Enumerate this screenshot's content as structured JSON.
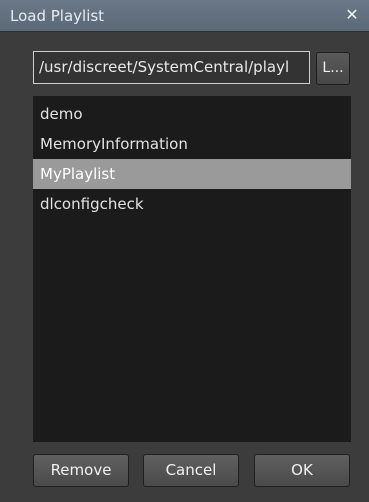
{
  "window": {
    "title": "Load Playlist",
    "close_glyph": "✕"
  },
  "path": {
    "value": "/usr/discreet/SystemCentral/playl",
    "browse_label": "L..."
  },
  "list": {
    "items": [
      "demo",
      "MemoryInformation",
      "MyPlaylist",
      "dlconfigcheck"
    ],
    "selected_index": 2
  },
  "buttons": {
    "remove": "Remove",
    "cancel": "Cancel",
    "ok": "OK"
  }
}
